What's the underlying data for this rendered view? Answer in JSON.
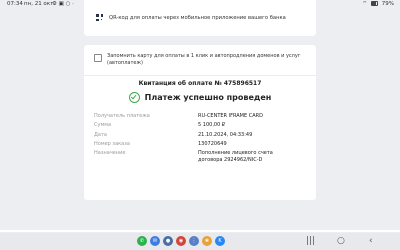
{
  "statusbar": {
    "time": "07:34",
    "date": "пн, 21 окт.",
    "extra": "⚙ ▣ ○ ·",
    "battery": "79%"
  },
  "qr": {
    "text": "QR-код для оплаты через мобильное приложение вашего банка"
  },
  "remember": {
    "text": "Запомнить карту для оплаты в 1 клик и автопродления доменов и услуг (автоплатеж)"
  },
  "receipt": {
    "title": "Квитанция об оплате № 475896517",
    "status": "Платеж успешно проведен",
    "rows": [
      {
        "label": "Получатель платежа",
        "value": "RU-CENTER IFRAME CARD"
      },
      {
        "label": "Сумма",
        "value": "5 100,00 ₽"
      },
      {
        "label": "Дата",
        "value": "21.10.2024, 04:33:49"
      },
      {
        "label": "Номер заказа",
        "value": "130720649"
      },
      {
        "label": "Назначение",
        "value": "Пополнение лицевого счета договора 2924962/NIC-D"
      }
    ]
  },
  "dock": [
    {
      "name": "phone-app-icon",
      "color": "#2bb24c",
      "glyph": "✆"
    },
    {
      "name": "messages-app-icon",
      "color": "#3f7de0",
      "glyph": "✉"
    },
    {
      "name": "chat-app-icon",
      "color": "#4a6fa5",
      "glyph": "●"
    },
    {
      "name": "camera-app-icon",
      "color": "#d2443c",
      "glyph": "◉"
    },
    {
      "name": "apps-grid-icon",
      "color": "#5a7fc9",
      "glyph": "⋮"
    },
    {
      "name": "photos-app-icon",
      "color": "#e8a23a",
      "glyph": "❀"
    },
    {
      "name": "vk-app-icon",
      "color": "#2787f5",
      "glyph": "K"
    }
  ],
  "nav": {
    "recents": "|||",
    "home": "○",
    "back": "‹"
  }
}
